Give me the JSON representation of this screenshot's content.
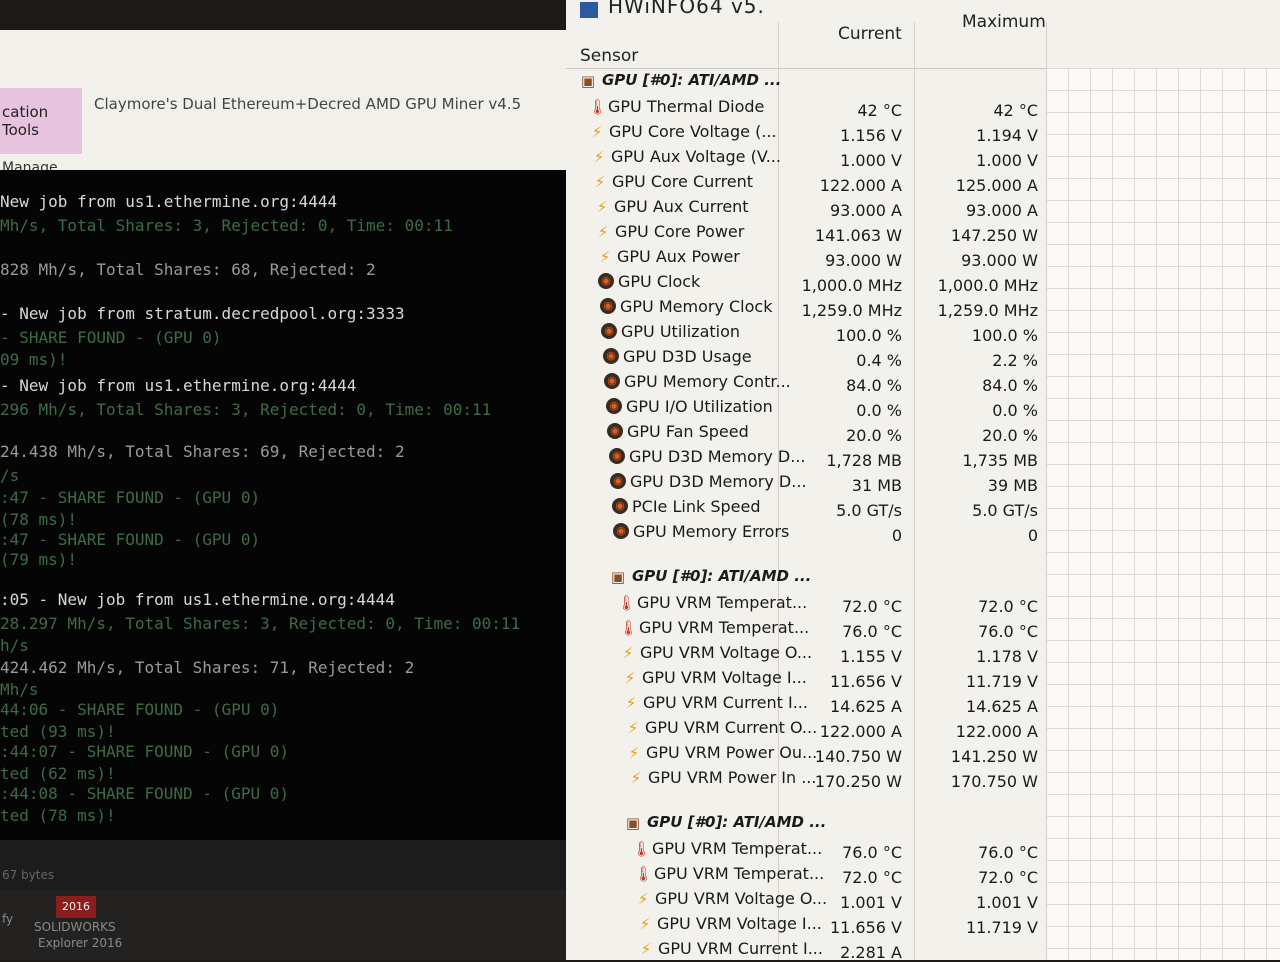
{
  "explorer": {
    "ribbon_tab": "cation Tools",
    "title": "Claymore's Dual Ethereum+Decred AMD GPU Miner v4.5",
    "manage": "Manage"
  },
  "console": {
    "lines": [
      {
        "text": " New job from us1.ethermine.org:4444",
        "style": "bright"
      },
      {
        "text": " Mh/s, Total Shares: 3, Rejected: 0, Time: 00:11",
        "style": "dim"
      },
      {
        "text": "828 Mh/s, Total Shares: 68, Rejected: 2",
        "style": "mid"
      },
      {
        "text": " - New job from stratum.decredpool.org:3333",
        "style": "bright"
      },
      {
        "text": " - SHARE FOUND - (GPU 0)",
        "style": "dim"
      },
      {
        "text": "09 ms)!",
        "style": "dim"
      },
      {
        "text": " - New job from us1.ethermine.org:4444",
        "style": "bright"
      },
      {
        "text": "296 Mh/s, Total Shares: 3, Rejected: 0, Time: 00:11",
        "style": "dim"
      },
      {
        "text": "24.438 Mh/s, Total Shares: 69, Rejected: 2",
        "style": "mid"
      },
      {
        "text": "/s",
        "style": "dim"
      },
      {
        "text": ":47 - SHARE FOUND - (GPU 0)",
        "style": "dim"
      },
      {
        "text": " (78 ms)!",
        "style": "dim"
      },
      {
        "text": ":47 - SHARE FOUND - (GPU 0)",
        "style": "dim"
      },
      {
        "text": " (79 ms)!",
        "style": "dim"
      },
      {
        "text": ":05 - New job from us1.ethermine.org:4444",
        "style": "bright"
      },
      {
        "text": " 28.297 Mh/s, Total Shares: 3, Rejected: 0, Time: 00:11",
        "style": "dim"
      },
      {
        "text": "h/s",
        "style": "dim"
      },
      {
        "text": " 424.462 Mh/s, Total Shares: 71, Rejected: 2",
        "style": "mid"
      },
      {
        "text": " Mh/s",
        "style": "dim"
      },
      {
        "text": "44:06 - SHARE FOUND - (GPU 0)",
        "style": "dim"
      },
      {
        "text": "ted (93 ms)!",
        "style": "dim"
      },
      {
        "text": ":44:07 - SHARE FOUND - (GPU 0)",
        "style": "dim"
      },
      {
        "text": "ted (62 ms)!",
        "style": "dim"
      },
      {
        "text": ":44:08 - SHARE FOUND - (GPU 0)",
        "style": "dim"
      },
      {
        "text": "ted (78 ms)!",
        "style": "dim"
      }
    ]
  },
  "statusbar": {
    "text": "67 bytes"
  },
  "taskbar": {
    "solidworks_year": "2016",
    "solidworks_label": "SOLIDWORKS",
    "explorer_label": "Explorer 2016",
    "left_fragment": "fy"
  },
  "hwinfo": {
    "title": "HWiNFO64 v5.",
    "headers": {
      "sensor": "Sensor",
      "current": "Current",
      "maximum": "Maximum"
    },
    "rows": [
      {
        "type": "group",
        "icon": "chip",
        "name": "GPU [#0]: ATI/AMD ...",
        "current": "",
        "max": ""
      },
      {
        "icon": "thermometer",
        "name": "GPU Thermal Diode",
        "current": "42 °C",
        "max": "42 °C"
      },
      {
        "icon": "bolt",
        "name": "GPU Core Voltage (...",
        "current": "1.156 V",
        "max": "1.194 V"
      },
      {
        "icon": "bolt",
        "name": "GPU Aux Voltage (V...",
        "current": "1.000 V",
        "max": "1.000 V"
      },
      {
        "icon": "bolt",
        "name": "GPU Core Current",
        "current": "122.000 A",
        "max": "125.000 A"
      },
      {
        "icon": "bolt",
        "name": "GPU Aux Current",
        "current": "93.000 A",
        "max": "93.000 A"
      },
      {
        "icon": "bolt",
        "name": "GPU Core Power",
        "current": "141.063 W",
        "max": "147.250 W"
      },
      {
        "icon": "bolt",
        "name": "GPU Aux Power",
        "current": "93.000 W",
        "max": "93.000 W"
      },
      {
        "icon": "gauge",
        "name": "GPU Clock",
        "current": "1,000.0 MHz",
        "max": "1,000.0 MHz"
      },
      {
        "icon": "gauge",
        "name": "GPU Memory Clock",
        "current": "1,259.0 MHz",
        "max": "1,259.0 MHz"
      },
      {
        "icon": "gauge",
        "name": "GPU Utilization",
        "current": "100.0 %",
        "max": "100.0 %"
      },
      {
        "icon": "gauge",
        "name": "GPU D3D Usage",
        "current": "0.4 %",
        "max": "2.2 %"
      },
      {
        "icon": "gauge",
        "name": "GPU Memory Contr...",
        "current": "84.0 %",
        "max": "84.0 %"
      },
      {
        "icon": "gauge",
        "name": "GPU I/O Utilization",
        "current": "0.0 %",
        "max": "0.0 %"
      },
      {
        "icon": "gauge",
        "name": "GPU Fan Speed",
        "current": "20.0 %",
        "max": "20.0 %"
      },
      {
        "icon": "gauge",
        "name": "GPU D3D Memory D...",
        "current": "1,728 MB",
        "max": "1,735 MB"
      },
      {
        "icon": "gauge",
        "name": "GPU D3D Memory D...",
        "current": "31 MB",
        "max": "39 MB"
      },
      {
        "icon": "gauge",
        "name": "PCIe Link Speed",
        "current": "5.0 GT/s",
        "max": "5.0 GT/s"
      },
      {
        "icon": "gauge",
        "name": "GPU Memory Errors",
        "current": "0",
        "max": "0"
      },
      {
        "type": "group",
        "icon": "chip",
        "name": "GPU [#0]: ATI/AMD ...",
        "current": "",
        "max": ""
      },
      {
        "icon": "thermometer",
        "name": "GPU VRM Temperat...",
        "current": "72.0 °C",
        "max": "72.0 °C"
      },
      {
        "icon": "thermometer",
        "name": "GPU VRM Temperat...",
        "current": "76.0 °C",
        "max": "76.0 °C"
      },
      {
        "icon": "bolt",
        "name": "GPU VRM Voltage O...",
        "current": "1.155 V",
        "max": "1.178 V"
      },
      {
        "icon": "bolt",
        "name": "GPU VRM Voltage I...",
        "current": "11.656 V",
        "max": "11.719 V"
      },
      {
        "icon": "bolt",
        "name": "GPU VRM Current I...",
        "current": "14.625 A",
        "max": "14.625 A"
      },
      {
        "icon": "bolt",
        "name": "GPU VRM Current O...",
        "current": "122.000 A",
        "max": "122.000 A"
      },
      {
        "icon": "bolt",
        "name": "GPU VRM Power Ou...",
        "current": "140.750 W",
        "max": "141.250 W"
      },
      {
        "icon": "bolt",
        "name": "GPU VRM Power In ...",
        "current": "170.250 W",
        "max": "170.750 W"
      },
      {
        "type": "group",
        "icon": "chip",
        "name": "GPU [#0]: ATI/AMD ...",
        "current": "",
        "max": ""
      },
      {
        "icon": "thermometer",
        "name": "GPU VRM Temperat...",
        "current": "76.0 °C",
        "max": "76.0 °C"
      },
      {
        "icon": "thermometer",
        "name": "GPU VRM Temperat...",
        "current": "72.0 °C",
        "max": "72.0 °C"
      },
      {
        "icon": "bolt",
        "name": "GPU VRM Voltage O...",
        "current": "1.001 V",
        "max": "1.001 V"
      },
      {
        "icon": "bolt",
        "name": "GPU VRM Voltage I...",
        "current": "11.656 V",
        "max": "11.719 V"
      },
      {
        "icon": "bolt",
        "name": "GPU VRM Current I...",
        "current": "2.281 A",
        "max": ""
      }
    ]
  }
}
